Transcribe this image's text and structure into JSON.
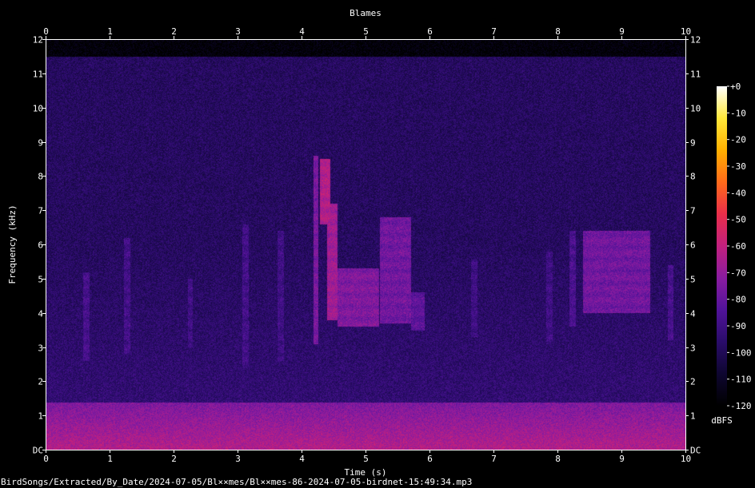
{
  "chart_data": {
    "type": "heatmap",
    "title": "Blames",
    "xlabel": "Time (s)",
    "ylabel": "Frequency (kHz)",
    "xlim": [
      0,
      10
    ],
    "ylim": [
      0,
      12
    ],
    "x_ticks": [
      "0",
      "1",
      "2",
      "3",
      "4",
      "5",
      "6",
      "7",
      "8",
      "9",
      "10"
    ],
    "y_ticks": [
      "DC",
      "1",
      "2",
      "3",
      "4",
      "5",
      "6",
      "7",
      "8",
      "9",
      "10",
      "11",
      "12"
    ],
    "colorbar": {
      "label": "dBFS",
      "range": [
        -120,
        0
      ],
      "ticks": [
        "+0",
        "-10",
        "-20",
        "-30",
        "-40",
        "-50",
        "-60",
        "-70",
        "-80",
        "-90",
        "-100",
        "-110",
        "-120"
      ],
      "colors": [
        "#000000",
        "#0e0630",
        "#2a0c6a",
        "#51139a",
        "#8a1ca0",
        "#c2207e",
        "#ea2e4a",
        "#ff6a1a",
        "#ffb000",
        "#ffe83a",
        "#ffffff"
      ]
    },
    "signal_ceiling_khz": 11.5,
    "background_level_dbfs": -98,
    "low_freq_band": {
      "freq_max": 1.4,
      "level_dbfs": -75
    },
    "events": [
      {
        "t0": 0.58,
        "t1": 0.68,
        "f0": 2.6,
        "f1": 5.2,
        "level_dbfs": -86
      },
      {
        "t0": 1.22,
        "t1": 1.32,
        "f0": 2.8,
        "f1": 6.2,
        "level_dbfs": -87
      },
      {
        "t0": 2.22,
        "t1": 2.3,
        "f0": 3.0,
        "f1": 5.0,
        "level_dbfs": -88
      },
      {
        "t0": 3.07,
        "t1": 3.17,
        "f0": 2.4,
        "f1": 6.6,
        "level_dbfs": -87
      },
      {
        "t0": 3.62,
        "t1": 3.72,
        "f0": 2.6,
        "f1": 6.4,
        "level_dbfs": -88
      },
      {
        "t0": 4.18,
        "t1": 4.26,
        "f0": 3.1,
        "f1": 8.6,
        "level_dbfs": -74
      },
      {
        "t0": 4.28,
        "t1": 4.44,
        "f0": 6.6,
        "f1": 8.5,
        "level_dbfs": -62
      },
      {
        "t0": 4.4,
        "t1": 4.56,
        "f0": 3.8,
        "f1": 7.2,
        "level_dbfs": -66
      },
      {
        "t0": 4.56,
        "t1": 5.2,
        "f0": 3.6,
        "f1": 5.3,
        "level_dbfs": -73
      },
      {
        "t0": 5.22,
        "t1": 5.7,
        "f0": 3.7,
        "f1": 6.8,
        "level_dbfs": -76
      },
      {
        "t0": 5.7,
        "t1": 5.92,
        "f0": 3.5,
        "f1": 4.6,
        "level_dbfs": -80
      },
      {
        "t0": 6.64,
        "t1": 6.74,
        "f0": 3.3,
        "f1": 5.6,
        "level_dbfs": -88
      },
      {
        "t0": 7.82,
        "t1": 7.92,
        "f0": 3.1,
        "f1": 5.8,
        "level_dbfs": -88
      },
      {
        "t0": 8.18,
        "t1": 8.28,
        "f0": 3.6,
        "f1": 6.4,
        "level_dbfs": -85
      },
      {
        "t0": 8.4,
        "t1": 9.44,
        "f0": 4.0,
        "f1": 6.4,
        "level_dbfs": -76
      },
      {
        "t0": 9.72,
        "t1": 9.8,
        "f0": 3.2,
        "f1": 5.4,
        "level_dbfs": -86
      }
    ],
    "source_file": "BirdSongs/Extracted/By_Date/2024-07-05/Bl××mes/Bl××mes-86-2024-07-05-birdnet-15:49:34.mp3"
  }
}
